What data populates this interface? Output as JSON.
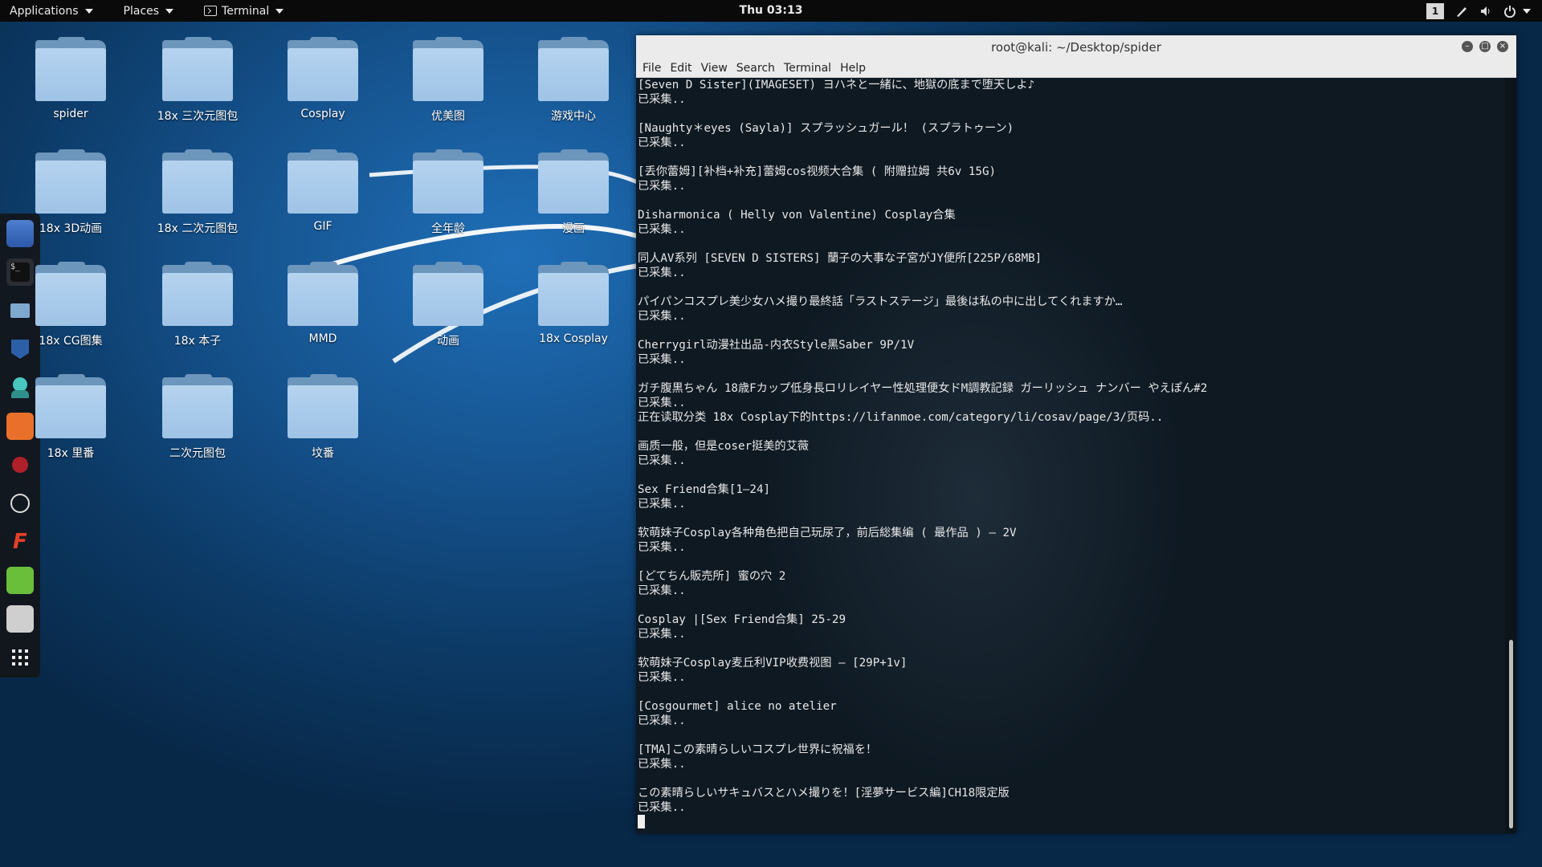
{
  "topbar": {
    "applications": "Applications",
    "places": "Places",
    "terminal": "Terminal",
    "clock": "Thu 03:13",
    "workspace": "1"
  },
  "desktop_icons": [
    {
      "label": "spider"
    },
    {
      "label": "18x 三次元图包"
    },
    {
      "label": "Cosplay"
    },
    {
      "label": "优美图"
    },
    {
      "label": "游戏中心"
    },
    {
      "label": "18x 3D动画"
    },
    {
      "label": "18x 二次元图包"
    },
    {
      "label": "GIF"
    },
    {
      "label": "全年龄"
    },
    {
      "label": "漫画"
    },
    {
      "label": "18x CG图集"
    },
    {
      "label": "18x 本子"
    },
    {
      "label": "MMD"
    },
    {
      "label": "动画"
    },
    {
      "label": "18x Cosplay"
    },
    {
      "label": "18x 里番"
    },
    {
      "label": "二次元图包"
    },
    {
      "label": "坟番"
    }
  ],
  "dock": [
    "app-icon",
    "terminal-icon",
    "files-icon",
    "metasploit-icon",
    "avatar-app-icon",
    "burpsuite-icon",
    "armitage-icon",
    "tool-icon",
    "faraday-icon",
    "notes-icon",
    "desktop-icon",
    "apps-grid-icon"
  ],
  "terminal": {
    "title": "root@kali: ~/Desktop/spider",
    "menu": [
      "File",
      "Edit",
      "View",
      "Search",
      "Terminal",
      "Help"
    ],
    "lines": [
      "[Seven D Sister](IMAGESET) ヨハネと一緒に、地獄の底まで堕天しよ♪",
      "已采集..",
      "",
      "[Naughty＊eyes (Sayla)] スプラッシュガール！ (スプラトゥーン)",
      "已采集..",
      "",
      "[丢你蕾姆][补档+补充]蕾姆cos视频大合集 ( 附赠拉姆 共6v 15G)",
      "已采集..",
      "",
      "Disharmonica ( Helly von Valentine) Cosplay合集",
      "已采集..",
      "",
      "同人AV系列 [SEVEN D SISTERS] 蘭子の大事な子宮がJY便所[225P/68MB]",
      "已采集..",
      "",
      "パイパンコスプレ美少女ハメ撮り最終話「ラストステージ」最後は私の中に出してくれますか…",
      "已采集..",
      "",
      "Cherrygirl动漫社出品-内衣Style黑Saber 9P/1V",
      "已采集..",
      "",
      "ガチ腹黒ちゃん 18歳Fカップ低身長ロリレイヤー性処理便女ドM調教記録 ガーリッシュ ナンバー やえぽん#2",
      "已采集..",
      "正在读取分类 18x Cosplay下的https://lifanmoe.com/category/li/cosav/page/3/页码..",
      "",
      "画质一般，但是coser挺美的艾薇",
      "已采集..",
      "",
      "Sex Friend合集[1—24]",
      "已采集..",
      "",
      "软萌妹子Cosplay各种角色把自己玩尿了，前后総集编 ( 最作品 ) — 2V",
      "已采集..",
      "",
      "[どてちん販売所] 蜜の穴 2",
      "已采集..",
      "",
      "Cosplay |[Sex Friend合集] 25-29",
      "已采集..",
      "",
      "软萌妹子Cosplay麦丘利VIP收费视图 — [29P+1v]",
      "已采集..",
      "",
      "[Cosgourmet] alice no atelier",
      "已采集..",
      "",
      "[TMA]この素晴らしいコスプレ世界に祝福を！",
      "已采集..",
      "",
      "この素晴らしいサキュバスとハメ撮りを！[淫夢サービス編]CH18限定版",
      "已采集.."
    ]
  }
}
